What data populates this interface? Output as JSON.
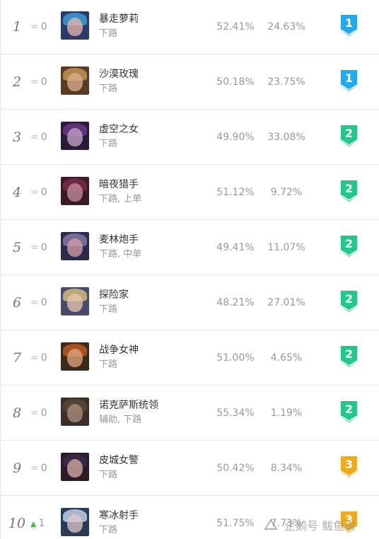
{
  "rows": [
    {
      "rank": "1",
      "change_symbol": "=",
      "change_value": "0",
      "change_dir": "same",
      "name": "暴走萝莉",
      "role": "下路",
      "win_rate": "52.41%",
      "pick_rate": "24.63%",
      "tier": "1",
      "tier_color": "#22aaee",
      "avatar_bg": "#2a3a6a",
      "avatar_hair": "#3fa0d8",
      "avatar_face": "#e8b8b0",
      "icon": "jinx-portrait-icon"
    },
    {
      "rank": "2",
      "change_symbol": "=",
      "change_value": "0",
      "change_dir": "same",
      "name": "沙漠玫瑰",
      "role": "下路",
      "win_rate": "50.18%",
      "pick_rate": "23.75%",
      "tier": "1",
      "tier_color": "#22aaee",
      "avatar_bg": "#5a3a22",
      "avatar_hair": "#c89a55",
      "avatar_face": "#e0b090",
      "icon": "samira-portrait-icon"
    },
    {
      "rank": "3",
      "change_symbol": "=",
      "change_value": "0",
      "change_dir": "same",
      "name": "虚空之女",
      "role": "下路",
      "win_rate": "49.90%",
      "pick_rate": "33.08%",
      "tier": "2",
      "tier_color": "#22c88a",
      "avatar_bg": "#2a1a3a",
      "avatar_hair": "#6a3a8a",
      "avatar_face": "#c8a8c8",
      "icon": "kaisa-portrait-icon"
    },
    {
      "rank": "4",
      "change_symbol": "=",
      "change_value": "0",
      "change_dir": "same",
      "name": "暗夜猎手",
      "role": "下路, 上单",
      "win_rate": "51.12%",
      "pick_rate": "9.72%",
      "tier": "2",
      "tier_color": "#22c88a",
      "avatar_bg": "#3a1a2a",
      "avatar_hair": "#7a2a4a",
      "avatar_face": "#c890a0",
      "icon": "vayne-portrait-icon"
    },
    {
      "rank": "5",
      "change_symbol": "=",
      "change_value": "0",
      "change_dir": "same",
      "name": "麦林炮手",
      "role": "下路, 中单",
      "win_rate": "49.41%",
      "pick_rate": "11.07%",
      "tier": "2",
      "tier_color": "#22c88a",
      "avatar_bg": "#2a2a4a",
      "avatar_hair": "#8a7aa8",
      "avatar_face": "#d8a0a8",
      "icon": "tristana-portrait-icon"
    },
    {
      "rank": "6",
      "change_symbol": "=",
      "change_value": "0",
      "change_dir": "same",
      "name": "探险家",
      "role": "下路",
      "win_rate": "48.21%",
      "pick_rate": "27.01%",
      "tier": "2",
      "tier_color": "#22c88a",
      "avatar_bg": "#4a4a6a",
      "avatar_hair": "#d8c080",
      "avatar_face": "#e8c8b0",
      "icon": "ezreal-portrait-icon"
    },
    {
      "rank": "7",
      "change_symbol": "=",
      "change_value": "0",
      "change_dir": "same",
      "name": "战争女神",
      "role": "下路",
      "win_rate": "51.00%",
      "pick_rate": "4.65%",
      "tier": "2",
      "tier_color": "#22c88a",
      "avatar_bg": "#3a2a1a",
      "avatar_hair": "#c05a20",
      "avatar_face": "#e0a880",
      "icon": "sivir-portrait-icon"
    },
    {
      "rank": "8",
      "change_symbol": "=",
      "change_value": "0",
      "change_dir": "same",
      "name": "诺克萨斯统领",
      "role": "辅助, 下路",
      "win_rate": "55.34%",
      "pick_rate": "1.19%",
      "tier": "2",
      "tier_color": "#22c88a",
      "avatar_bg": "#3a3028",
      "avatar_hair": "#5a4a3a",
      "avatar_face": "#b09080",
      "icon": "swain-portrait-icon"
    },
    {
      "rank": "9",
      "change_symbol": "=",
      "change_value": "0",
      "change_dir": "same",
      "name": "皮城女警",
      "role": "下路",
      "win_rate": "50.42%",
      "pick_rate": "8.34%",
      "tier": "3",
      "tier_color": "#f0aa1a",
      "avatar_bg": "#2a1a2a",
      "avatar_hair": "#3a2a4a",
      "avatar_face": "#d8b0a8",
      "icon": "caitlyn-portrait-icon"
    },
    {
      "rank": "10",
      "change_symbol": "▲",
      "change_value": "1",
      "change_dir": "up",
      "name": "寒冰射手",
      "role": "下路",
      "win_rate": "51.75%",
      "pick_rate": "7.73%",
      "tier": "3",
      "tier_color": "#f0aa1a",
      "avatar_bg": "#2a3a5a",
      "avatar_hair": "#c8d8f0",
      "avatar_face": "#e0c8c8",
      "icon": "ashe-portrait-icon"
    }
  ],
  "watermark": {
    "text": "企鹅号 鲅鱼讲",
    "icon": "watermark-logo-icon"
  }
}
